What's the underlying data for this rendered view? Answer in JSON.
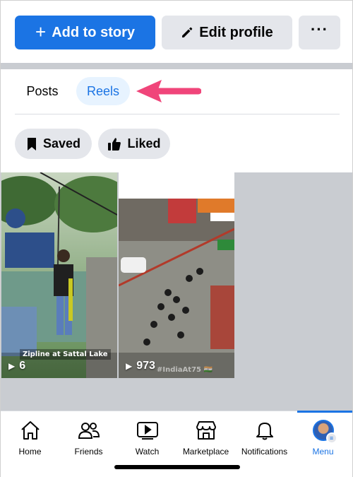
{
  "actions": {
    "add_story_label": "Add to story",
    "add_story_icon": "plus-icon",
    "edit_profile_label": "Edit profile",
    "edit_profile_icon": "pencil-icon",
    "more_label": "···"
  },
  "tabs": [
    {
      "label": "Posts",
      "active": false
    },
    {
      "label": "Reels",
      "active": true
    }
  ],
  "filters": [
    {
      "label": "Saved",
      "icon": "bookmark-icon"
    },
    {
      "label": "Liked",
      "icon": "thumbs-up-icon"
    }
  ],
  "reels": [
    {
      "caption": "Zipline at Sattal Lake",
      "views": "6"
    },
    {
      "caption": "#IndiaAt75 🇮🇳",
      "views": "973"
    }
  ],
  "nav": [
    {
      "label": "Home",
      "icon": "home-icon"
    },
    {
      "label": "Friends",
      "icon": "friends-icon"
    },
    {
      "label": "Watch",
      "icon": "watch-icon"
    },
    {
      "label": "Marketplace",
      "icon": "marketplace-icon"
    },
    {
      "label": "Notifications",
      "icon": "bell-icon"
    },
    {
      "label": "Menu",
      "icon": "avatar-icon",
      "active": true
    }
  ],
  "colors": {
    "accent": "#1b74e4",
    "pill_bg": "#e4e6eb",
    "active_tab_bg": "#e7f3ff",
    "arrow": "#f0457a"
  }
}
